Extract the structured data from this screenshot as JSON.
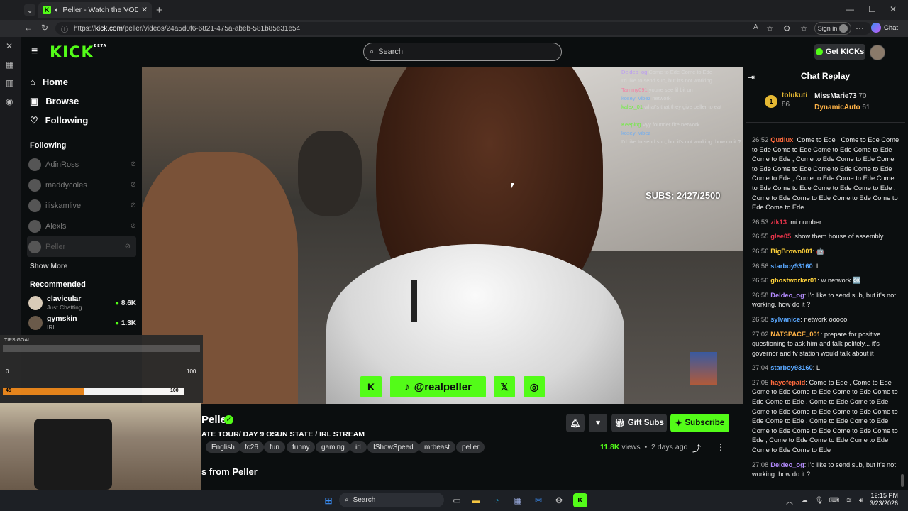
{
  "browser": {
    "tab_title": "Peller - Watch the VOD on Ki",
    "url_prefix": "https://",
    "url_host": "kick.com",
    "url_path": "/peller/videos/24a5d0f6-6821-475a-abeb-581b85e31e54",
    "signin_label": "Sign in",
    "chat_label": "Chat"
  },
  "header": {
    "logo": "KICK",
    "logo_badge": "BETA",
    "search_placeholder": "Search",
    "get_kicks_label": "Get KICKs"
  },
  "sidebar": {
    "nav": [
      {
        "label": "Home",
        "icon": "home-icon"
      },
      {
        "label": "Browse",
        "icon": "browse-icon"
      },
      {
        "label": "Following",
        "icon": "heart-icon"
      }
    ],
    "following_title": "Following",
    "following": [
      {
        "name": "AdinRoss"
      },
      {
        "name": "maddycoles"
      },
      {
        "name": "iliskamlive"
      },
      {
        "name": "Alexis"
      },
      {
        "name": "Peller"
      }
    ],
    "show_more": "Show More",
    "recommended_title": "Recommended",
    "recommended": [
      {
        "name": "clavicular",
        "category": "Just Chatting",
        "viewers": "8.6K"
      },
      {
        "name": "gymskin",
        "category": "IRL",
        "viewers": "1.3K"
      }
    ]
  },
  "video": {
    "subs_overlay": "SUBS: 2427/2500",
    "overlay_chat": [
      {
        "user": "Deldeo_og",
        "msg": "Come to Ede Come to Ede"
      },
      {
        "user": "",
        "msg": "I'd like to send sub, but it's not working"
      },
      {
        "user": "Tammy091",
        "msg": "you're see lil bit on"
      },
      {
        "user": "kosey_vibez",
        "msg": "network"
      },
      {
        "user": "kalex_01",
        "msg": "what's that they give peller to eat"
      },
      {
        "user": "",
        "msg": ""
      },
      {
        "user": "Keeping",
        "msg": "Vyy founder fire network"
      },
      {
        "user": "kosey_vibez",
        "msg": ""
      },
      {
        "user": "",
        "msg": "I'd like to send sub, but it's not working. how do it ?"
      }
    ],
    "social_handle": "@realpeller"
  },
  "stream_info": {
    "streamer": "Peller",
    "title": "ATE TOUR/ DAY 9 OSUN STATE / IRL STREAM",
    "tags": [
      "English",
      "fc26",
      "fun",
      "funny",
      "gaming",
      "irl",
      "IShowSpeed",
      "mrbeast",
      "peller"
    ],
    "gift_subs": "Gift Subs",
    "subscribe": "Subscribe",
    "views": "11.8K",
    "views_label": "views",
    "age": "2 days ago",
    "from_label": "s from Peller"
  },
  "chat": {
    "title": "Chat Replay",
    "leaders": [
      {
        "rank": "1",
        "name": "tolukuti",
        "value": "86"
      },
      {
        "name": "MissMarie73",
        "value": "70"
      },
      {
        "name": "DynamicAuto",
        "value": "61"
      }
    ],
    "messages": [
      {
        "time": "26:52",
        "user": "Qudlux",
        "color": "#ff6a3d",
        "text": "Come to Ede , Come to Ede Come to Ede Come to Ede Come to Ede Come to Ede Come to Ede , Come to Ede Come to Ede Come to Ede Come to Ede Come to Ede Come to Ede Come to Ede , Come to Ede Come to Ede Come to Ede Come to Ede Come to Ede Come to Ede , Come to Ede Come to Ede Come to Ede Come to Ede Come to Ede"
      },
      {
        "time": "26:53",
        "user": "zik13",
        "color": "#e8344a",
        "text": "mi number"
      },
      {
        "time": "26:55",
        "user": "glee05",
        "color": "#e8344a",
        "text": "show them house of assembly"
      },
      {
        "time": "26:56",
        "user": "BigBrown001",
        "color": "#ffd23a",
        "text": "🤖"
      },
      {
        "time": "26:56",
        "user": "starboy93160",
        "color": "#5aa8ff",
        "text": "L"
      },
      {
        "time": "26:56",
        "user": "ghostworker01",
        "color": "#ffd23a",
        "text": "w network 🆗"
      },
      {
        "time": "26:58",
        "user": "Deldeo_og",
        "color": "#b48cff",
        "text": "I'd like to send sub, but it's not working. how do it ?"
      },
      {
        "time": "26:58",
        "user": "sylvanice",
        "color": "#5aa8ff",
        "text": "network ooooo"
      },
      {
        "time": "27:02",
        "user": "NATSPACE_001",
        "color": "#ffb347",
        "text": "prepare for positive questioning to ask him and talk politely... it's governor and tv station would talk about it"
      },
      {
        "time": "27:04",
        "user": "starboy93160",
        "color": "#5aa8ff",
        "text": "L"
      },
      {
        "time": "27:05",
        "user": "hayofepaid",
        "color": "#ff6a3d",
        "text": "Come to Ede , Come to Ede Come to Ede Come to Ede Come to Ede Come to Ede Come to Ede , Come to Ede Come to Ede Come to Ede Come to Ede Come to Ede Come to Ede Come to Ede , Come to Ede Come to Ede Come to Ede Come to Ede Come to Ede Come to Ede , Come to Ede Come to Ede Come to Ede Come to Ede Come to Ede"
      },
      {
        "time": "27:08",
        "user": "Deldeo_og",
        "color": "#b48cff",
        "text": "I'd like to send sub, but it's not working. how do it ?"
      }
    ]
  },
  "stream_overlay": {
    "tips_goal": "TIPS GOAL",
    "scale_min": "0",
    "scale_max": "100",
    "bar_left": "45",
    "bar_right": "100",
    "progress": 0.45
  },
  "taskbar": {
    "search_placeholder": "Search",
    "time": "12:15 PM",
    "date": "3/23/2026"
  },
  "colors": {
    "accent": "#53fc18",
    "bg": "#0b0e0f",
    "panel": "#2f3134"
  }
}
